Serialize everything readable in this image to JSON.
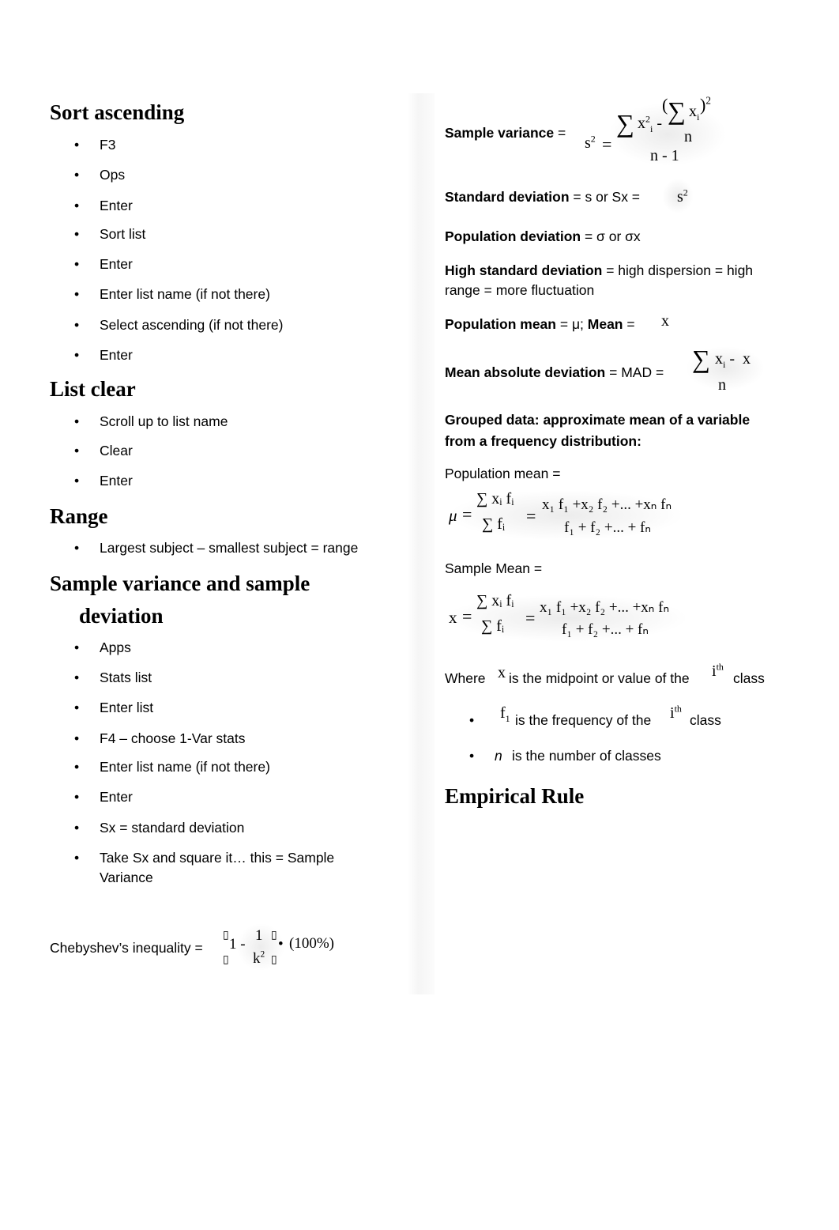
{
  "left_column": {
    "sections": [
      {
        "heading": "Sort ascending",
        "items": [
          "F3",
          "Ops",
          "Enter",
          "Sort list",
          "Enter",
          "Enter list name (if not there)",
          "Select ascending (if not there)",
          "Enter"
        ]
      },
      {
        "heading": "List clear",
        "items": [
          "Scroll up to list name",
          "Clear",
          "Enter"
        ]
      },
      {
        "heading": "Range",
        "items": [
          "Largest subject – smallest subject = range"
        ]
      },
      {
        "heading_line1": "Sample variance and sample",
        "heading_line2": "deviation",
        "items": [
          "Apps",
          "Stats list",
          "Enter list",
          "F4 – choose 1-Var stats",
          "Enter list name (if not there)",
          "Enter",
          "Sx = standard deviation",
          "Take Sx and square it… this = Sample",
          "Variance"
        ]
      }
    ],
    "chebyshev": {
      "label": "Chebyshev’s inequality =",
      "bracket_placeholder": "▯",
      "one_minus": "1 -",
      "numerator": "1",
      "denominator": "k",
      "exponent": "2",
      "dot": "•",
      "percent": "(100%)"
    }
  },
  "right_column": {
    "sample_variance": {
      "label": "Sample variance",
      "eq": "=",
      "lhs": "s",
      "lhs_exp": "2",
      "equals": "=",
      "sigma": "∑",
      "x": "x",
      "sub_i": "i",
      "sup_2": "2",
      "minus": "-",
      "lparen": "(",
      "rparen": ")",
      "n": "n",
      "denominator": "n - 1"
    },
    "standard_deviation": {
      "label": "Standard deviation",
      "rest": "= s or Sx =",
      "sym": "s",
      "exp": "2"
    },
    "population_deviation": {
      "label": "Population deviation",
      "rest": "= σ or σx"
    },
    "high_sd": {
      "label": "High standard deviation",
      "rest_line1": "= high dispersion = high",
      "line2": "range = more fluctuation"
    },
    "means": {
      "label1": "Population mean",
      "rest1": "= μ;",
      "label2": "Mean",
      "rest2": "=",
      "sym": "x"
    },
    "mad": {
      "label": "Mean absolute deviation",
      "rest": "= MAD =",
      "sigma": "∑",
      "numerator_x": "x",
      "sub_i": "i",
      "minus": "-",
      "xbar": "x",
      "denominator": "n"
    },
    "grouped": {
      "line1": "Grouped data: approximate mean of a variable",
      "line2": "from a frequency distribution:"
    },
    "population_mean_label": "Population mean =",
    "population_mean_formula": {
      "lhs": "μ",
      "eq": "=",
      "num": "∑ xᵢ fᵢ",
      "den": "∑ fᵢ",
      "eq2": "=",
      "expanded_num": "x₁ f₁ +x₂ f₂ +... +xₙ fₙ",
      "expanded_den": "f₁ + f₂ +... + fₙ"
    },
    "sample_mean_label": "Sample Mean =",
    "sample_mean_formula": {
      "lhs": "x",
      "eq": "=",
      "num": "∑ xᵢ fᵢ",
      "den": "∑ fᵢ",
      "eq2": "=",
      "expanded_num": "x₁ f₁ +x₂ f₂ +... +xₙ fₙ",
      "expanded_den": "f₁ + f₂ +... + fₙ"
    },
    "where": {
      "prefix": "Where",
      "sym": "x",
      "middle": "is the midpoint or value of the",
      "ith": "i",
      "th": "th",
      "suffix": "class"
    },
    "notes": [
      {
        "sym": "f",
        "sub": "1",
        "text": "is the frequency of the",
        "ith": "i",
        "th": "th",
        "suffix": "class"
      },
      {
        "sym": "n",
        "text": "is the number of classes"
      }
    ],
    "empirical_heading": "Empirical Rule"
  }
}
